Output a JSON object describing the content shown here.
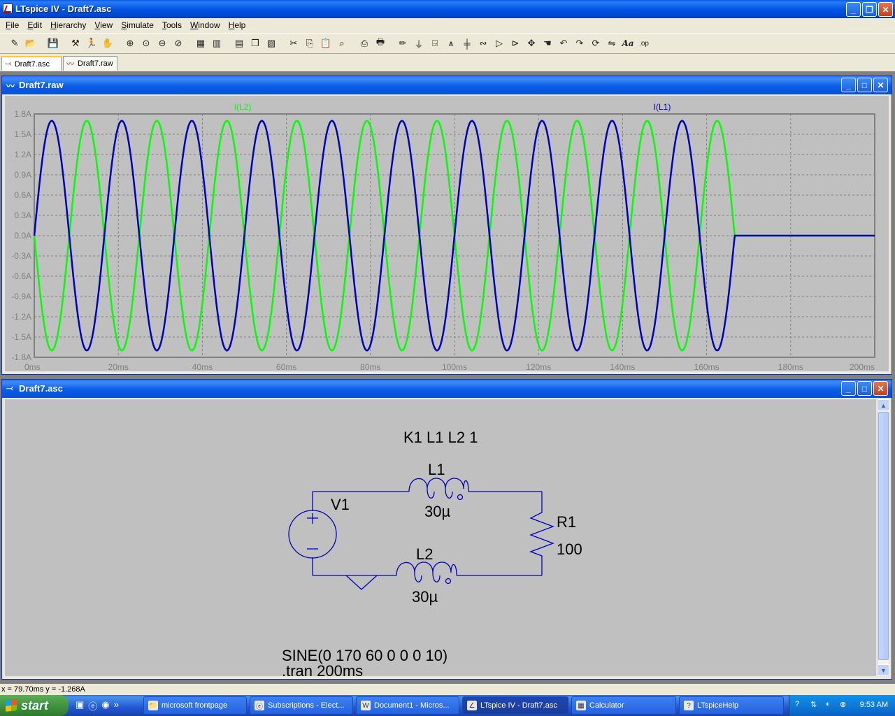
{
  "window": {
    "title": "LTspice IV - Draft7.asc"
  },
  "menu": [
    {
      "pre": "",
      "u": "F",
      "post": "ile"
    },
    {
      "pre": "",
      "u": "E",
      "post": "dit"
    },
    {
      "pre": "",
      "u": "H",
      "post": "ierarchy"
    },
    {
      "pre": "",
      "u": "V",
      "post": "iew"
    },
    {
      "pre": "",
      "u": "S",
      "post": "imulate"
    },
    {
      "pre": "",
      "u": "T",
      "post": "ools"
    },
    {
      "pre": "",
      "u": "W",
      "post": "indow"
    },
    {
      "pre": "",
      "u": "H",
      "post": "elp"
    }
  ],
  "toolbar": {
    "icons": [
      "new-schematic-icon",
      "open-icon",
      "sep",
      "save-icon",
      "sep",
      "control-panel-icon",
      "run-icon",
      "halt-icon",
      "sep",
      "zoom-in-icon",
      "zoom-pan-icon",
      "zoom-out-icon",
      "zoom-cancel-icon",
      "sep",
      "autorange-icon",
      "grid-icon",
      "sep",
      "tile-horizontal-icon",
      "cascade-icon",
      "tile-vertical-icon",
      "sep",
      "cut-icon",
      "copy-icon",
      "paste-icon",
      "find-icon",
      "sep",
      "print-setup-icon",
      "print-icon",
      "sep",
      "wire-icon",
      "ground-icon",
      "label-net-icon",
      "resistor-icon",
      "capacitor-icon",
      "inductor-icon",
      "diode-icon",
      "component-icon",
      "move-icon",
      "drag-icon",
      "undo-icon",
      "redo-icon",
      "rotate-icon",
      "mirror-icon",
      "text-icon",
      "spice-directive-icon"
    ],
    "text_label": "Aa",
    "op_label": ".op"
  },
  "tabs": [
    {
      "label": "Draft7.asc",
      "active": true
    },
    {
      "label": "Draft7.raw",
      "active": false
    }
  ],
  "plot_window": {
    "title": "Draft7.raw"
  },
  "schematic_window": {
    "title": "Draft7.asc"
  },
  "chart_data": {
    "type": "line",
    "x_unit": "ms",
    "xlim": [
      0,
      200
    ],
    "ylim": [
      -1.8,
      1.8
    ],
    "x_ticks": [
      "0ms",
      "20ms",
      "40ms",
      "60ms",
      "80ms",
      "100ms",
      "120ms",
      "140ms",
      "160ms",
      "180ms",
      "200ms"
    ],
    "y_ticks": [
      "1.8A",
      "1.5A",
      "1.2A",
      "0.9A",
      "0.6A",
      "0.3A",
      "0.0A",
      "-0.3A",
      "-0.6A",
      "-0.9A",
      "-1.2A",
      "-1.5A",
      "-1.8A"
    ],
    "grid": true,
    "series": [
      {
        "name": "I(L2)",
        "color": "#00ff00",
        "amplitude": 1.7,
        "frequency_hz": 60,
        "phase": "-sin",
        "end_ms": 166.7,
        "after": 0
      },
      {
        "name": "I(L1)",
        "color": "#0000c0",
        "amplitude": 1.7,
        "frequency_hz": 60,
        "phase": "+sin",
        "end_ms": 166.7,
        "after": 0
      }
    ]
  },
  "schematic": {
    "k_directive": "K1 L1 L2 1",
    "l1_name": "L1",
    "l1_value": "30µ",
    "l2_name": "L2",
    "l2_value": "30µ",
    "v1_name": "V1",
    "r1_name": "R1",
    "r1_value": "100",
    "source_value": "SINE(0 170 60 0 0 0 10)",
    "tran_directive": ".tran 200ms"
  },
  "status": {
    "text": "x = 79.70ms    y = -1.268A"
  },
  "taskbar": {
    "start_label": "start",
    "quick_launch": [
      "show-desktop-icon",
      "internet-explorer-icon",
      "media-icon",
      "more-icon"
    ],
    "tasks": [
      {
        "label": "microsoft frontpage",
        "icon": "folder-icon",
        "active": false
      },
      {
        "label": "Subscriptions - Elect...",
        "icon": "ie-icon",
        "active": false
      },
      {
        "label": "Document1 - Micros...",
        "icon": "word-icon",
        "active": false
      },
      {
        "label": "LTspice IV - Draft7.asc",
        "icon": "ltspice-icon",
        "active": true
      },
      {
        "label": "Calculator",
        "icon": "calculator-icon",
        "active": false
      },
      {
        "label": "LTspiceHelp",
        "icon": "help-icon",
        "active": false
      }
    ],
    "clock": "9:53 AM"
  }
}
